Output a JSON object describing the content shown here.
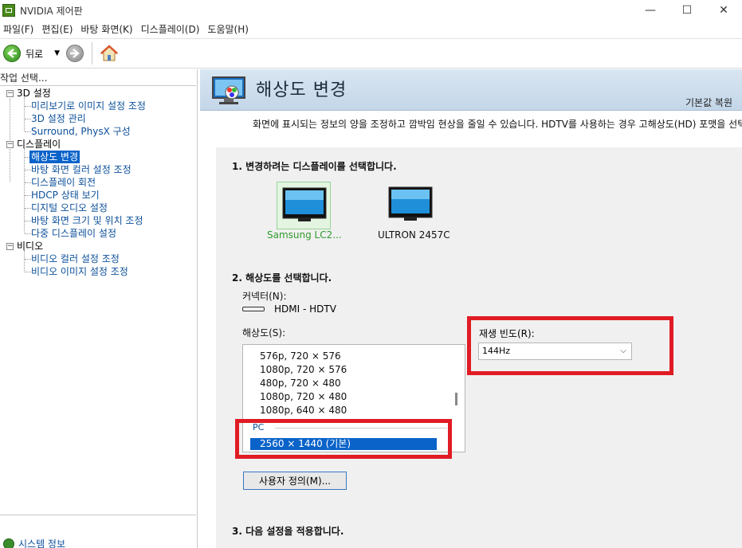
{
  "window": {
    "title": "NVIDIA 제어판",
    "minimize": "—",
    "maximize": "☐",
    "close": "✕"
  },
  "menu": [
    "파일(F)",
    "편집(E)",
    "바탕 화면(K)",
    "디스플레이(D)",
    "도움말(H)"
  ],
  "toolbar": {
    "back_label": "뒤로"
  },
  "left": {
    "task_header": "작업 선택...",
    "tree": [
      {
        "label": "3D 설정",
        "type": "category"
      },
      {
        "label": "미리보기로 이미지 설정 조정",
        "type": "link"
      },
      {
        "label": "3D 설정 관리",
        "type": "link"
      },
      {
        "label": "Surround, PhysX 구성",
        "type": "link"
      },
      {
        "label": "디스플레이",
        "type": "category"
      },
      {
        "label": "해상도 변경",
        "type": "link",
        "selected": true
      },
      {
        "label": "바탕 화면 컬러 설정 조정",
        "type": "link"
      },
      {
        "label": "디스플레이 회전",
        "type": "link"
      },
      {
        "label": "HDCP 상태 보기",
        "type": "link"
      },
      {
        "label": "디지털 오디오 설정",
        "type": "link"
      },
      {
        "label": "바탕 화면 크기 및 위치 조정",
        "type": "link"
      },
      {
        "label": "다중 디스플레이 설정",
        "type": "link"
      },
      {
        "label": "비디오",
        "type": "category"
      },
      {
        "label": "비디오 컬러 설정 조정",
        "type": "link"
      },
      {
        "label": "비디오 이미지 설정 조정",
        "type": "link"
      }
    ],
    "system_info": "시스템 정보"
  },
  "main": {
    "title": "해상도 변경",
    "restore_default": "기본값 복원",
    "description": "화면에 표시되는 정보의 양을 조정하고 깜박임 현상을 줄일 수 있습니다. HDTV를 사용하는 경우 고해상도(HD) 포맷을 선택하",
    "step1": "1. 변경하려는 디스플레이를 선택합니다.",
    "displays": [
      {
        "name": "Samsung LC2...",
        "selected": true
      },
      {
        "name": "ULTRON 2457C",
        "selected": false
      }
    ],
    "step2": "2. 해상도를 선택합니다.",
    "connector_label": "커넥터(N):",
    "connector_value": "HDMI - HDTV",
    "resolution_label": "해상도(S):",
    "resolution_items": [
      "576p, 720 × 576",
      "1080p, 720 × 576",
      "480p, 720 × 480",
      "1080p, 720 × 480",
      "1080p, 640 × 480"
    ],
    "resolution_group": "PC",
    "resolution_selected": "2560 × 1440 (기본)",
    "refresh_label": "재생 빈도(R):",
    "refresh_value": "144Hz",
    "custom_button": "사용자 정의(M)...",
    "step3": "3. 다음 설정을 적용합니다."
  }
}
